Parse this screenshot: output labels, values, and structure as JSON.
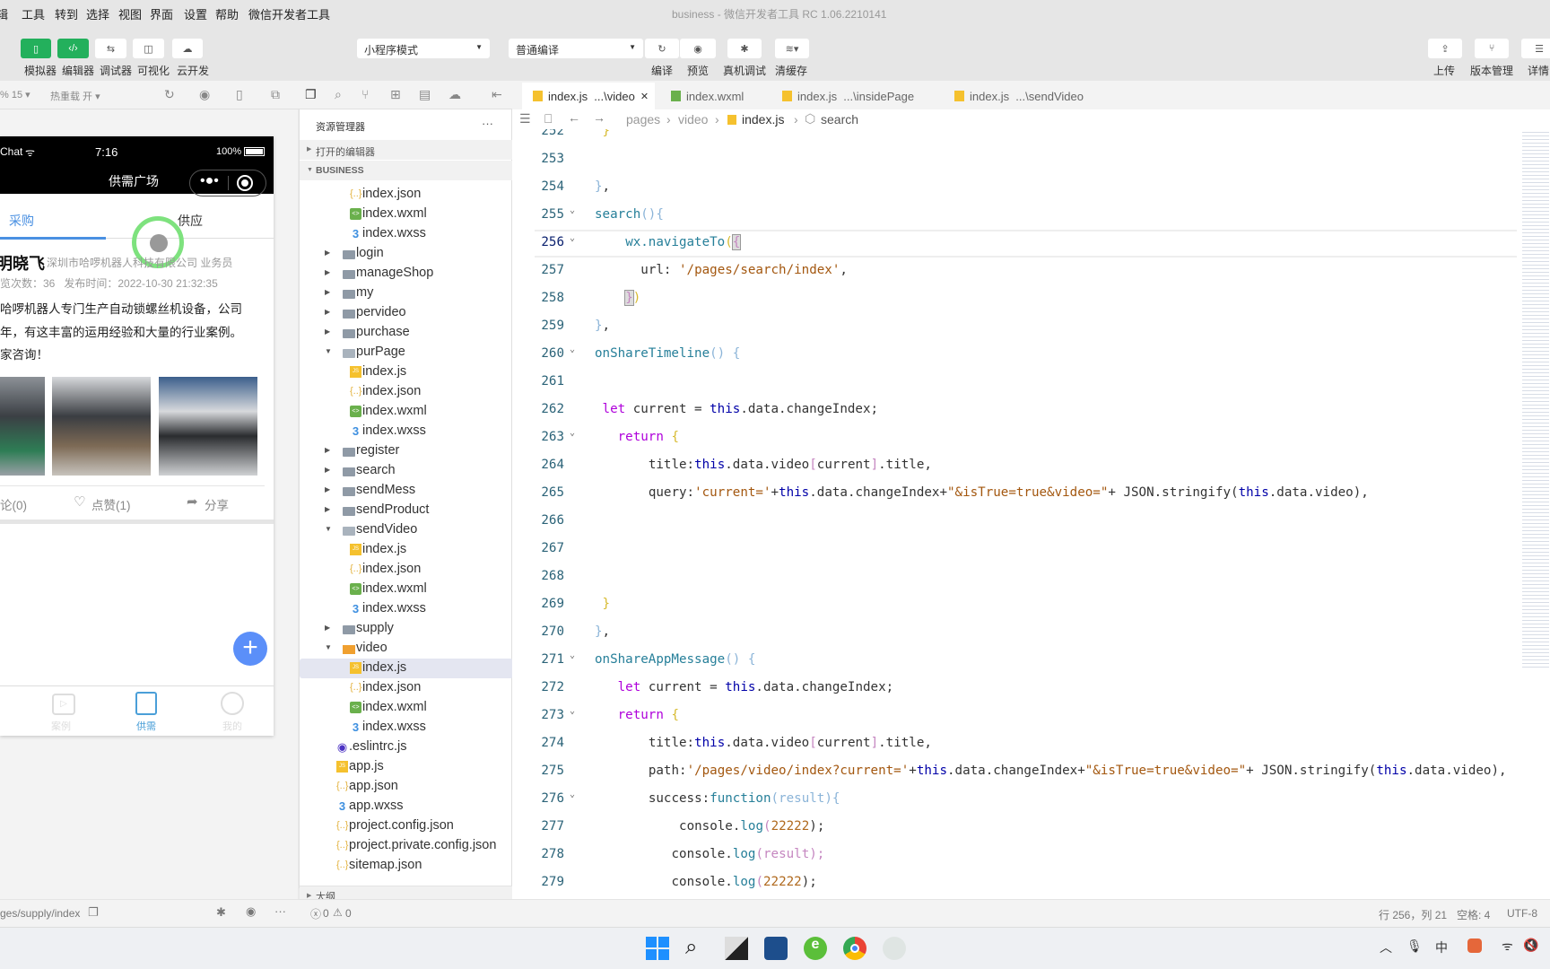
{
  "window_title": "business - 微信开发者工具 RC 1.06.2210141",
  "menu": [
    "辑",
    "工具",
    "转到",
    "选择",
    "视图",
    "界面",
    "设置",
    "帮助",
    "微信开发者工具"
  ],
  "toolbar": {
    "left_buttons": [
      {
        "label": "模拟器",
        "icon": "phone-icon"
      },
      {
        "label": "编辑器",
        "icon": "code-icon"
      },
      {
        "label": "调试器",
        "icon": "debug-sliders-icon"
      },
      {
        "label": "可视化",
        "icon": "layout-icon"
      },
      {
        "label": "云开发",
        "icon": "cloud-icon"
      }
    ],
    "mode_select": "小程序模式",
    "compile_select": "普通编译",
    "compile_label": "编译",
    "preview_label": "预览",
    "remote_debug_label": "真机调试",
    "clear_cache_label": "清缓存",
    "upload_label": "上传",
    "version_label": "版本管理",
    "details_label": "详情"
  },
  "subbar": {
    "zoom": "% 15 ▾",
    "hot_reload": "热重载 开 ▾"
  },
  "simulator": {
    "status_carrier": "Chat",
    "status_time": "7:16",
    "status_battery": "100%",
    "nav_title": "供需广场",
    "tabs": [
      "采购",
      "供应"
    ],
    "post": {
      "author": "明晓飞",
      "company": "深圳市哈啰机器人科技有限公司 业务员",
      "stats": "览次数：36   发布时间：2022-10-30 21:32:35",
      "lines": [
        "哈啰机器人专门生产自动锁螺丝机设备，公司",
        "年，有这丰富的运用经验和大量的行业案例。",
        "家咨询！"
      ],
      "comment": "论(0)",
      "like": "点赞(1)",
      "share": "分享"
    },
    "bottom_tabs": [
      "案例",
      "供需",
      "我的"
    ],
    "active_bottom_tab": "供需",
    "path": "ges/supply/index"
  },
  "explorer": {
    "title": "资源管理器",
    "more": "···",
    "open_editors": "打开的编辑器",
    "project": "BUSINESS",
    "outline": "大纲",
    "rows": [
      {
        "name": "index.json",
        "type": "json",
        "level": 2
      },
      {
        "name": "index.wxml",
        "type": "wxml",
        "level": 2
      },
      {
        "name": "index.wxss",
        "type": "wxss",
        "level": 2
      },
      {
        "name": "login",
        "type": "folder",
        "level": 1
      },
      {
        "name": "manageShop",
        "type": "folder",
        "level": 1
      },
      {
        "name": "my",
        "type": "folder",
        "level": 1
      },
      {
        "name": "pervideo",
        "type": "folder",
        "level": 1
      },
      {
        "name": "purchase",
        "type": "folder",
        "level": 1
      },
      {
        "name": "purPage",
        "type": "folder-open",
        "level": 1
      },
      {
        "name": "index.js",
        "type": "js",
        "level": 2
      },
      {
        "name": "index.json",
        "type": "json",
        "level": 2
      },
      {
        "name": "index.wxml",
        "type": "wxml",
        "level": 2
      },
      {
        "name": "index.wxss",
        "type": "wxss",
        "level": 2
      },
      {
        "name": "register",
        "type": "folder",
        "level": 1
      },
      {
        "name": "search",
        "type": "folder",
        "level": 1
      },
      {
        "name": "sendMess",
        "type": "folder",
        "level": 1
      },
      {
        "name": "sendProduct",
        "type": "folder",
        "level": 1
      },
      {
        "name": "sendVideo",
        "type": "folder-open",
        "level": 1
      },
      {
        "name": "index.js",
        "type": "js",
        "level": 2
      },
      {
        "name": "index.json",
        "type": "json",
        "level": 2
      },
      {
        "name": "index.wxml",
        "type": "wxml",
        "level": 2
      },
      {
        "name": "index.wxss",
        "type": "wxss",
        "level": 2
      },
      {
        "name": "supply",
        "type": "folder",
        "level": 1
      },
      {
        "name": "video",
        "type": "folder-video",
        "level": 1
      },
      {
        "name": "index.js",
        "type": "js",
        "level": 2,
        "selected": true
      },
      {
        "name": "index.json",
        "type": "json",
        "level": 2
      },
      {
        "name": "index.wxml",
        "type": "wxml",
        "level": 2
      },
      {
        "name": "index.wxss",
        "type": "wxss",
        "level": 2
      },
      {
        "name": ".eslintrc.js",
        "type": "eslint",
        "level": 0
      },
      {
        "name": "app.js",
        "type": "js",
        "level": 0
      },
      {
        "name": "app.json",
        "type": "json",
        "level": 0
      },
      {
        "name": "app.wxss",
        "type": "wxss",
        "level": 0
      },
      {
        "name": "project.config.json",
        "type": "json",
        "level": 0
      },
      {
        "name": "project.private.config.json",
        "type": "json",
        "level": 0
      },
      {
        "name": "sitemap.json",
        "type": "json",
        "level": 0
      }
    ],
    "errors": "0",
    "warnings": "0"
  },
  "editor": {
    "tabs": [
      {
        "label": "index.js  ...\\video",
        "type": "js",
        "active": true,
        "closable": true
      },
      {
        "label": "index.wxml",
        "type": "wxml"
      },
      {
        "label": "index.js  ...\\insidePage",
        "type": "js"
      },
      {
        "label": "index.js  ...\\sendVideo",
        "type": "js"
      }
    ],
    "breadcrumb": [
      "pages",
      "video",
      "index.js",
      "search"
    ],
    "current_line": 256,
    "lines": [
      {
        "n": 252,
        "i": 1,
        "t": [
          [
            "}",
            "y"
          ]
        ]
      },
      {
        "n": 253,
        "i": 0,
        "t": []
      },
      {
        "n": 254,
        "i": 0,
        "t": [
          [
            "}",
            "bl"
          ],
          [
            ",",
            "p"
          ]
        ]
      },
      {
        "n": 255,
        "i": 0,
        "fold": true,
        "t": [
          [
            "search",
            "f"
          ],
          [
            "(){",
            "bl"
          ]
        ]
      },
      {
        "n": 256,
        "i": 4,
        "fold": true,
        "t": [
          [
            "wx.navigateTo",
            "f"
          ],
          [
            "(",
            "y"
          ],
          [
            "{",
            "pk mb"
          ]
        ]
      },
      {
        "n": 257,
        "i": 6,
        "t": [
          [
            "url: ",
            "p"
          ],
          [
            "'/pages/search/index'",
            "s"
          ],
          [
            ",",
            "p"
          ]
        ]
      },
      {
        "n": 258,
        "i": 4,
        "t": [
          [
            "}",
            "pk mb"
          ],
          [
            ")",
            "y"
          ]
        ]
      },
      {
        "n": 259,
        "i": 0,
        "t": [
          [
            "}",
            "bl"
          ],
          [
            ",",
            "p"
          ]
        ]
      },
      {
        "n": 260,
        "i": 0,
        "fold": true,
        "t": [
          [
            "onShareTimeline",
            "f"
          ],
          [
            "() {",
            "bl"
          ]
        ]
      },
      {
        "n": 261,
        "i": 0,
        "t": []
      },
      {
        "n": 262,
        "i": 1,
        "t": [
          [
            "let ",
            "k"
          ],
          [
            "current = ",
            "p"
          ],
          [
            "this",
            ""
          ],
          [
            ".data.changeIndex;",
            "p"
          ]
        ]
      },
      {
        "n": 263,
        "i": 3,
        "fold": true,
        "t": [
          [
            "return ",
            "k"
          ],
          [
            "{",
            "y"
          ]
        ]
      },
      {
        "n": 264,
        "i": 7,
        "t": [
          [
            "title:",
            "p"
          ],
          [
            "this",
            "t"
          ],
          [
            ".data.video",
            "p"
          ],
          [
            "[",
            "pk"
          ],
          [
            "current",
            "p"
          ],
          [
            "]",
            "pk"
          ],
          [
            ".title,",
            "p"
          ]
        ]
      },
      {
        "n": 265,
        "i": 7,
        "t": [
          [
            "query:",
            "p"
          ],
          [
            "'current='",
            "s"
          ],
          [
            "+",
            "p"
          ],
          [
            "this",
            "t"
          ],
          [
            ".data.changeIndex+",
            "p"
          ],
          [
            "\"&isTrue=true&video=\"",
            "s"
          ],
          [
            "+ JSON.stringify(",
            "p"
          ],
          [
            "this",
            "t"
          ],
          [
            ".data.video),",
            "p"
          ]
        ]
      },
      {
        "n": 266,
        "i": 0,
        "t": []
      },
      {
        "n": 267,
        "i": 0,
        "t": []
      },
      {
        "n": 268,
        "i": 0,
        "t": []
      },
      {
        "n": 269,
        "i": 1,
        "t": [
          [
            "}",
            "y"
          ]
        ]
      },
      {
        "n": 270,
        "i": 0,
        "t": [
          [
            "}",
            "bl"
          ],
          [
            ",",
            "p"
          ]
        ]
      },
      {
        "n": 271,
        "i": 0,
        "fold": true,
        "t": [
          [
            "onShareAppMessage",
            "f"
          ],
          [
            "() {",
            "bl"
          ]
        ]
      },
      {
        "n": 272,
        "i": 3,
        "t": [
          [
            "let ",
            "k"
          ],
          [
            "current = ",
            "p"
          ],
          [
            "this",
            "t"
          ],
          [
            ".data.changeIndex;",
            "p"
          ]
        ]
      },
      {
        "n": 273,
        "i": 3,
        "fold": true,
        "t": [
          [
            "return ",
            "k"
          ],
          [
            "{",
            "y"
          ]
        ]
      },
      {
        "n": 274,
        "i": 7,
        "t": [
          [
            "title:",
            "p"
          ],
          [
            "this",
            "t"
          ],
          [
            ".data.video",
            "p"
          ],
          [
            "[",
            "pk"
          ],
          [
            "current",
            "p"
          ],
          [
            "]",
            "pk"
          ],
          [
            ".title,",
            "p"
          ]
        ]
      },
      {
        "n": 275,
        "i": 7,
        "t": [
          [
            "path:",
            "p"
          ],
          [
            "'/pages/video/index?current='",
            "s"
          ],
          [
            "+",
            "p"
          ],
          [
            "this",
            "t"
          ],
          [
            ".data.changeIndex+",
            "p"
          ],
          [
            "\"&isTrue=true&video=\"",
            "s"
          ],
          [
            "+ JSON.stringify(",
            "p"
          ],
          [
            "this",
            "t"
          ],
          [
            ".data.video),",
            "p"
          ]
        ]
      },
      {
        "n": 276,
        "i": 7,
        "fold": true,
        "t": [
          [
            "success:",
            "p"
          ],
          [
            "function",
            "f"
          ],
          [
            "(result){",
            "bl"
          ]
        ]
      },
      {
        "n": 277,
        "i": 11,
        "t": [
          [
            "console.",
            "p"
          ],
          [
            "log",
            "f"
          ],
          [
            "(",
            "pk"
          ],
          [
            "22222",
            "n"
          ],
          [
            ");",
            "p"
          ]
        ]
      },
      {
        "n": 278,
        "i": 10,
        "t": [
          [
            "console.",
            "p"
          ],
          [
            "log",
            "f"
          ],
          [
            "(result);",
            "pk"
          ]
        ]
      },
      {
        "n": 279,
        "i": 10,
        "t": [
          [
            "console.",
            "p"
          ],
          [
            "log",
            "f"
          ],
          [
            "(",
            "pk"
          ],
          [
            "22222",
            "n"
          ],
          [
            ");",
            "p"
          ]
        ]
      }
    ]
  },
  "statusbar": {
    "position": "行 256，列 21",
    "indent": "空格: 4",
    "encoding": "UTF-8"
  },
  "taskbar": [
    "windows-start-icon",
    "search-icon",
    "task-view-icon",
    "store-icon",
    "ie-browser-icon",
    "chrome-icon",
    "wechat-devtools-icon"
  ],
  "colors": {
    "accent_green": "#23b05c",
    "tab_blue": "#4a90e2",
    "fab_blue": "#5b8ff9",
    "selected_row": "#e4e6f1"
  }
}
